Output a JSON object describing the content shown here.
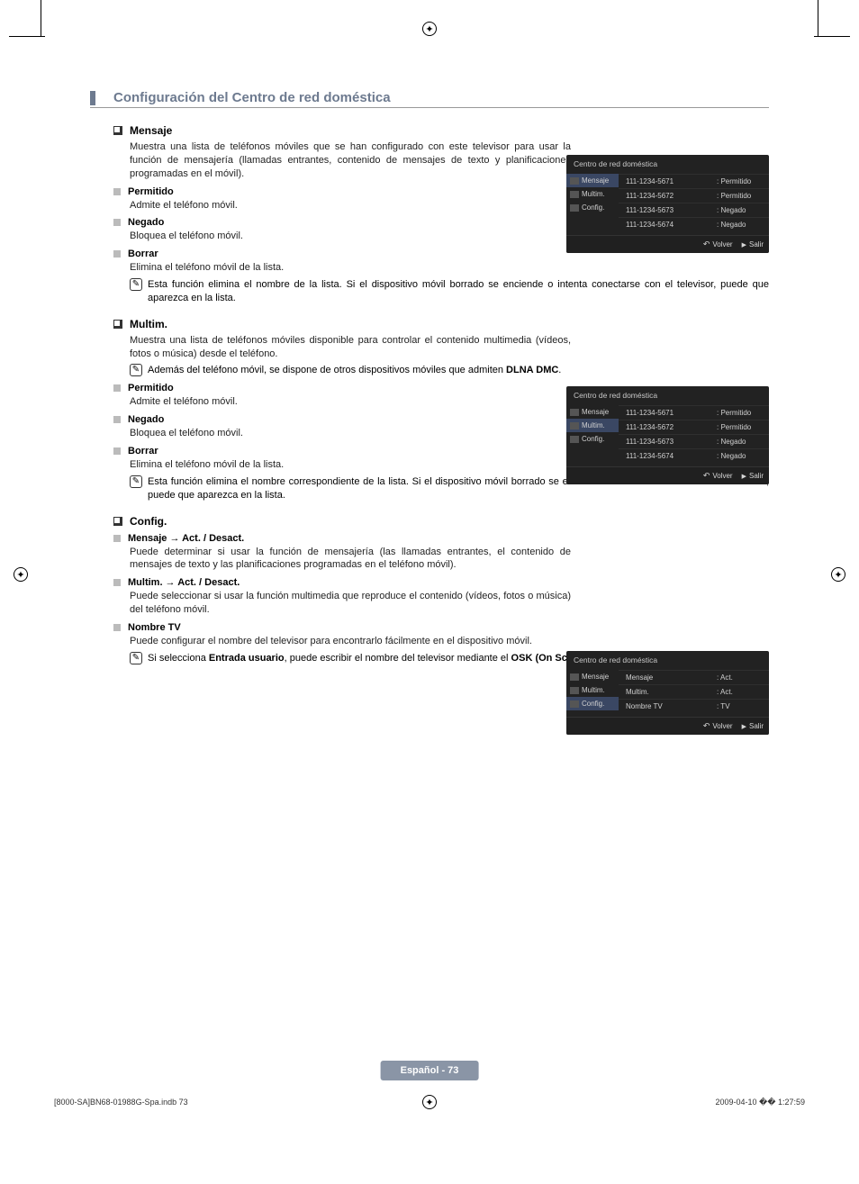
{
  "header": {
    "title": "Configuración del Centro de red doméstica"
  },
  "mensaje": {
    "title": "Mensaje",
    "intro": "Muestra una lista de teléfonos móviles que se han configurado con este televisor para usar la función de mensajería (llamadas entrantes, contenido de mensajes de texto y planificaciones programadas en el móvil).",
    "permitido_h": "Permitido",
    "permitido_t": "Admite el teléfono móvil.",
    "negado_h": "Negado",
    "negado_t": "Bloquea el teléfono móvil.",
    "borrar_h": "Borrar",
    "borrar_t": "Elimina el teléfono móvil de la lista.",
    "note": "Esta función elimina el nombre de la lista. Si el dispositivo móvil borrado se enciende o intenta conectarse con el televisor, puede que aparezca en la lista."
  },
  "multim": {
    "title": "Multim.",
    "intro": "Muestra una lista de teléfonos móviles disponible para controlar el contenido multimedia (vídeos, fotos o música) desde el teléfono.",
    "note1_pre": "Además del teléfono móvil, se dispone de otros dispositivos móviles que admiten ",
    "note1_bold": "DLNA DMC",
    "permitido_h": "Permitido",
    "permitido_t": "Admite el teléfono móvil.",
    "negado_h": "Negado",
    "negado_t": "Bloquea el teléfono móvil.",
    "borrar_h": "Borrar",
    "borrar_t": "Elimina el teléfono móvil de la lista.",
    "note2": "Esta función elimina el nombre correspondiente de la lista. Si el dispositivo móvil borrado se enciende o intenta conectarse con el televisor, puede que aparezca en la lista."
  },
  "config": {
    "title": "Config.",
    "m1_h": "Mensaje → Act. / Desact.",
    "m1_t": "Puede determinar si usar la función de mensajería (las llamadas entrantes, el contenido de mensajes de texto y las planificaciones programadas en el teléfono móvil).",
    "m2_h": "Multim. → Act. / Desact.",
    "m2_t": "Puede seleccionar si usar la función multimedia que reproduce el contenido (vídeos, fotos o música) del teléfono móvil.",
    "m3_h": "Nombre TV",
    "m3_t": "Puede configurar el nombre del televisor para encontrarlo fácilmente en el dispositivo móvil.",
    "note_pre": "Si selecciona ",
    "note_b1": "Entrada usuario",
    "note_mid": ", puede escribir el nombre del televisor mediante el ",
    "note_b2": "OSK (On Screen Keyboard)",
    "note_post": "."
  },
  "panel_common": {
    "title": "Centro de red doméstica",
    "side": {
      "mensaje": "Mensaje",
      "multim": "Multim.",
      "config": "Config."
    },
    "footer": {
      "volver": "Volver",
      "salir": "Salir"
    }
  },
  "panel1": {
    "selected": 0,
    "rows": [
      {
        "n": "111-1234-5671",
        "s": ": Permitido"
      },
      {
        "n": "111-1234-5672",
        "s": ": Permitido"
      },
      {
        "n": "111-1234-5673",
        "s": ": Negado"
      },
      {
        "n": "111-1234-5674",
        "s": ": Negado"
      }
    ]
  },
  "panel2": {
    "selected": 1,
    "rows": [
      {
        "n": "111-1234-5671",
        "s": ": Permitido"
      },
      {
        "n": "111-1234-5672",
        "s": ": Permitido"
      },
      {
        "n": "111-1234-5673",
        "s": ": Negado"
      },
      {
        "n": "111-1234-5674",
        "s": ": Negado"
      }
    ]
  },
  "panel3": {
    "selected": 2,
    "rows": [
      {
        "n": "Mensaje",
        "s": ": Act."
      },
      {
        "n": "Multim.",
        "s": ": Act."
      },
      {
        "n": "Nombre TV",
        "s": ": TV"
      }
    ]
  },
  "page_label": "Español - 73",
  "footer": {
    "left": "[8000-SA]BN68-01988G-Spa.indb   73",
    "right": "2009-04-10   �� 1:27:59"
  }
}
